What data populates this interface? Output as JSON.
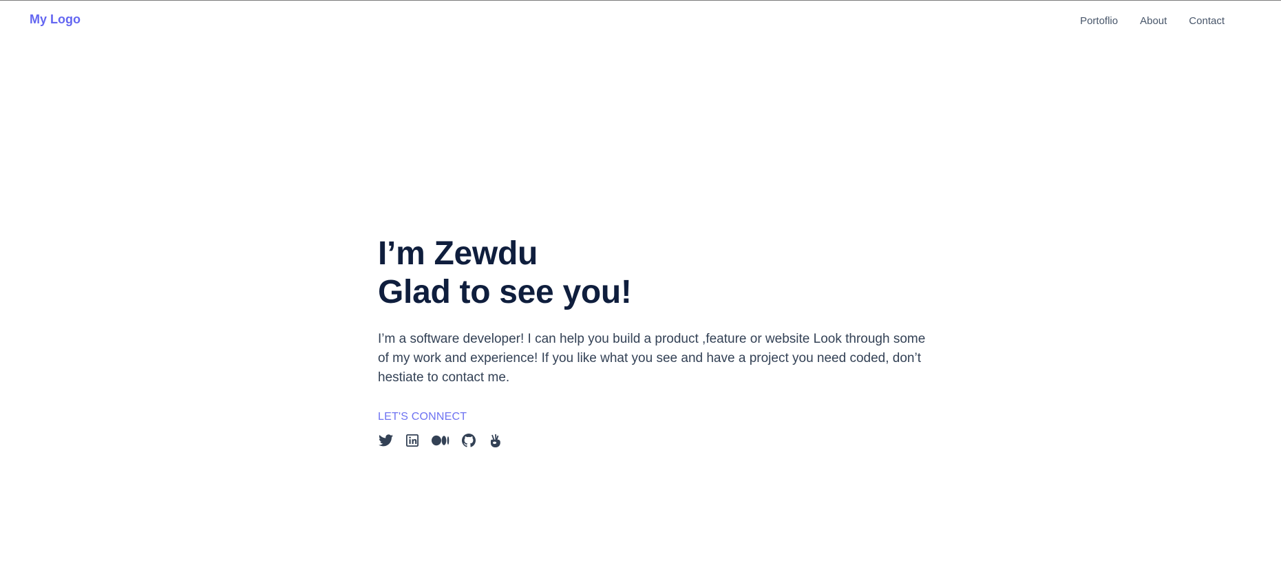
{
  "header": {
    "logo": "My Logo",
    "nav": [
      {
        "label": "Portoflio"
      },
      {
        "label": "About"
      },
      {
        "label": "Contact"
      }
    ]
  },
  "hero": {
    "title_line1": "I’m Zewdu",
    "title_line2": "Glad to see you!",
    "description": "I’m a software developer! I can help you build a product ,feature or website Look through some of my work and experience! If you like what you see and have a project you need coded, don’t hestiate to contact me.",
    "connect_label": "LET'S CONNECT",
    "socials": [
      {
        "icon": "twitter-icon"
      },
      {
        "icon": "linkedin-icon"
      },
      {
        "icon": "medium-icon"
      },
      {
        "icon": "github-icon"
      },
      {
        "icon": "wellfound-icon"
      }
    ]
  },
  "colors": {
    "accent": "#6366f1",
    "heading": "#0f1e3d",
    "body_text": "#334155",
    "nav_text": "#475569"
  }
}
